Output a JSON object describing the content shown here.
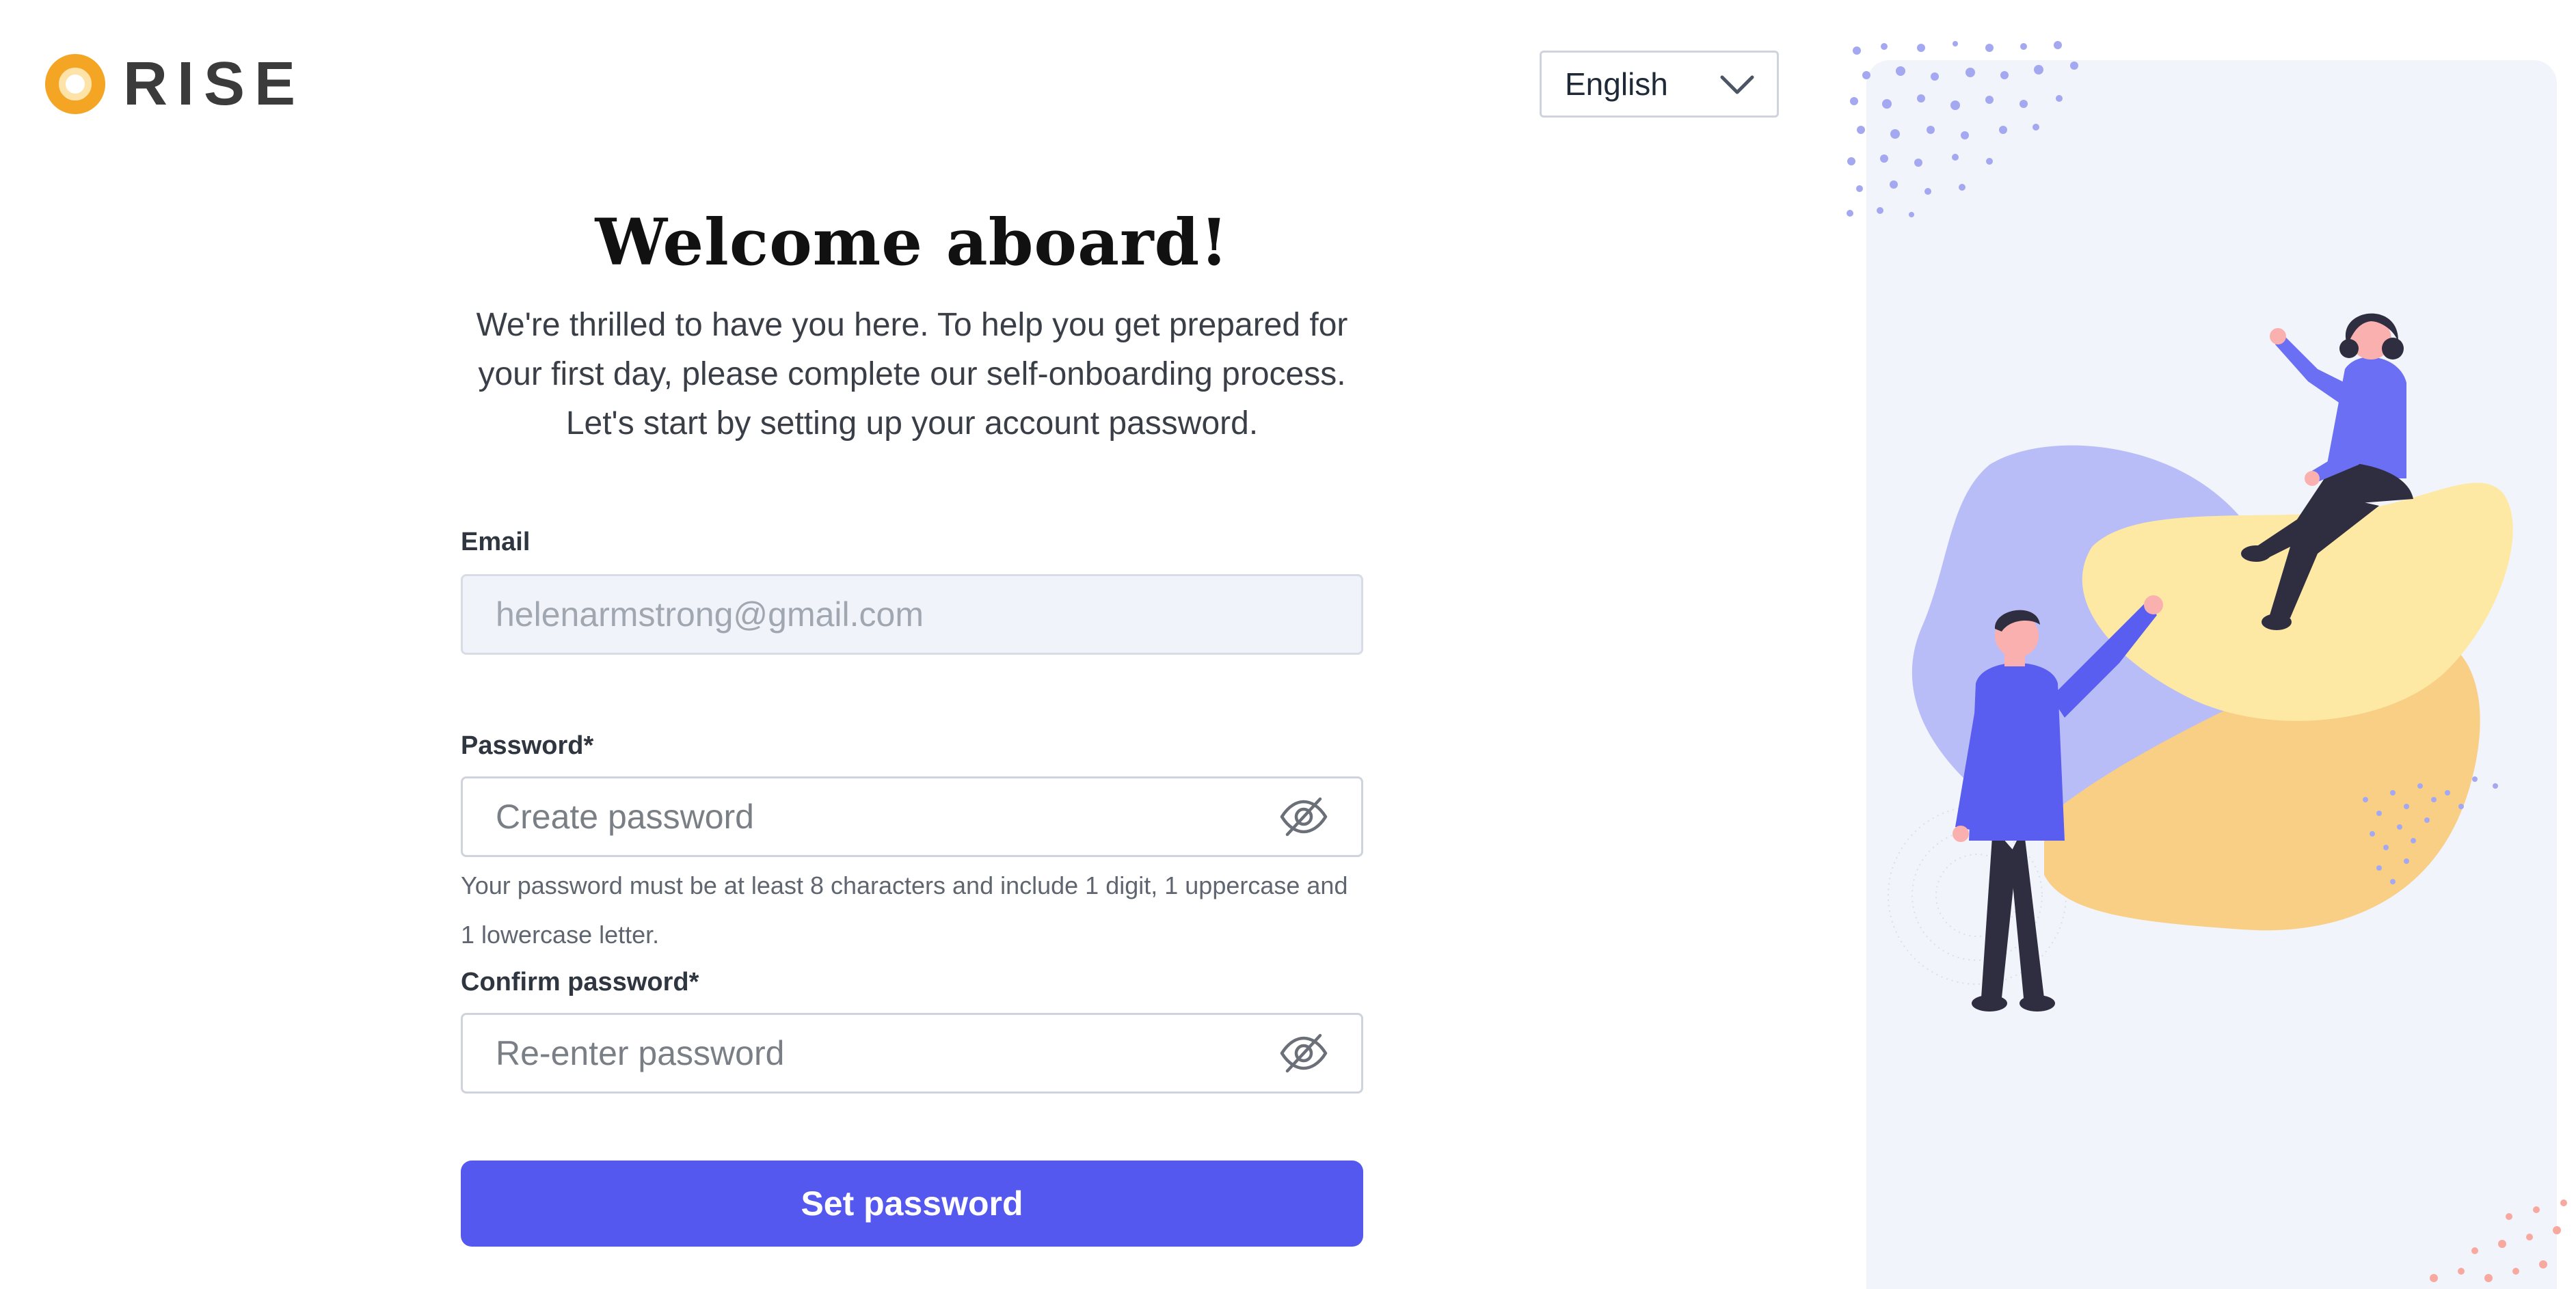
{
  "brand": {
    "name": "RISE",
    "logo_color": "#f5a524"
  },
  "language": {
    "selected": "English"
  },
  "onboarding": {
    "title": "Welcome aboard!",
    "subtitle": "We're thrilled to have you here. To help you get prepared for your first day, please complete our self-onboarding process. Let's start by setting up your account password."
  },
  "form": {
    "email": {
      "label": "Email",
      "value": "helenarmstrong@gmail.com"
    },
    "password": {
      "label": "Password",
      "required_mark": "*",
      "placeholder": "Create password",
      "hint": "Your password must be at least 8 characters and include 1 digit, 1 uppercase and 1 lowercase letter.",
      "toggle_icon": "eye-off-icon"
    },
    "confirm_password": {
      "label": "Confirm password",
      "required_mark": "*",
      "placeholder": "Re-enter password",
      "toggle_icon": "eye-off-icon"
    },
    "submit_label": "Set password"
  },
  "colors": {
    "primary": "#5558ef",
    "panel_bg": "#f1f4fa",
    "illustration_purple": "#b9bdf7",
    "illustration_yellow": "#fde9a4",
    "illustration_orange": "#f9cf86"
  },
  "illustration": {
    "name": "onboarding-people-illustration"
  }
}
